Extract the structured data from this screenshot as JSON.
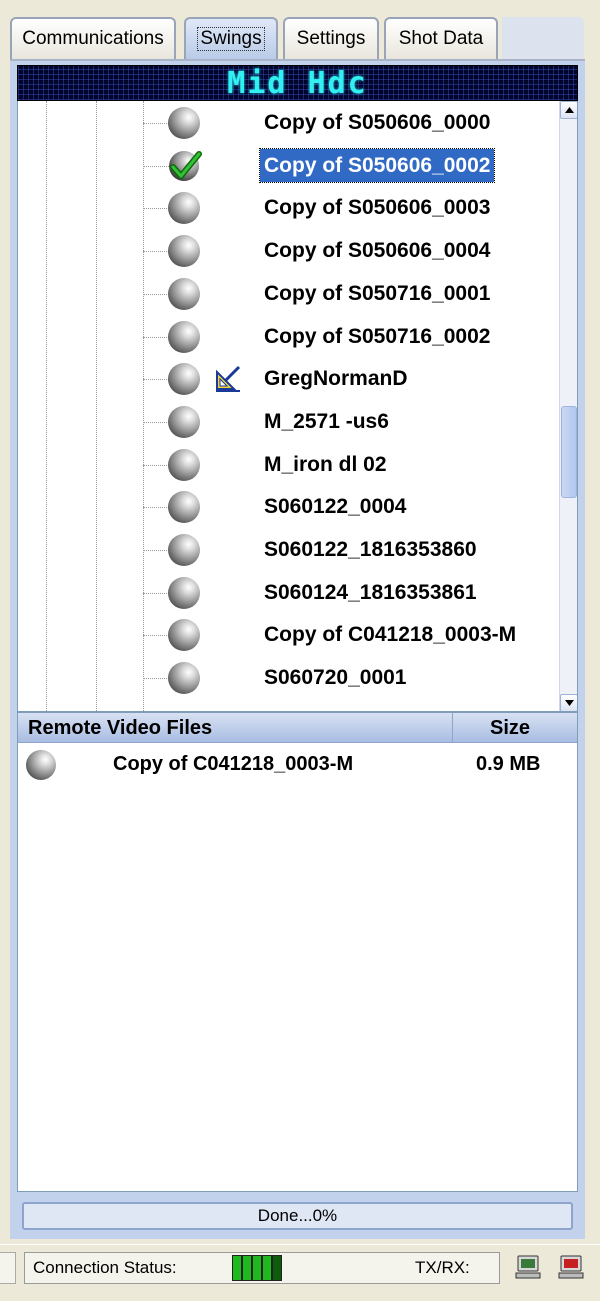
{
  "tabs": [
    {
      "label": "Communications",
      "active": false
    },
    {
      "label": "Swings",
      "active": true
    },
    {
      "label": "Settings",
      "active": false
    },
    {
      "label": "Shot Data",
      "active": false
    }
  ],
  "lcd_title": "Mid Hdc",
  "swing_tree": {
    "items": [
      {
        "label": "Copy of S050606_0000",
        "icon": "golf-ball-icon",
        "selected": false
      },
      {
        "label": "Copy of S050606_0002",
        "icon": "green-check-icon",
        "selected": true
      },
      {
        "label": "Copy of S050606_0003",
        "icon": "golf-ball-icon",
        "selected": false
      },
      {
        "label": "Copy of S050606_0004",
        "icon": "golf-ball-icon",
        "selected": false
      },
      {
        "label": "Copy of S050716_0001",
        "icon": "golf-ball-icon",
        "selected": false
      },
      {
        "label": "Copy of S050716_0002",
        "icon": "golf-ball-icon",
        "selected": false
      },
      {
        "label": "GregNormanD",
        "icon": "golf-ball-icon",
        "extra_icon": "drawing-tool-icon",
        "selected": false
      },
      {
        "label": "M_2571 -us6",
        "icon": "golf-ball-icon",
        "selected": false
      },
      {
        "label": "M_iron dl 02",
        "icon": "golf-ball-icon",
        "selected": false
      },
      {
        "label": "S060122_0004",
        "icon": "golf-ball-icon",
        "selected": false
      },
      {
        "label": "S060122_1816353860",
        "icon": "golf-ball-icon",
        "selected": false
      },
      {
        "label": "S060124_1816353861",
        "icon": "golf-ball-icon",
        "selected": false
      },
      {
        "label": "Copy of C041218_0003-M",
        "icon": "golf-ball-icon",
        "selected": false
      },
      {
        "label": "S060720_0001",
        "icon": "golf-ball-icon",
        "selected": false
      }
    ]
  },
  "remote_files": {
    "columns": {
      "name": "Remote Video Files",
      "size": "Size"
    },
    "rows": [
      {
        "name": "Copy of C041218_0003-M",
        "size": "0.9 MB"
      }
    ]
  },
  "progress": {
    "text": "Done...0%",
    "percent": 0
  },
  "status_bar": {
    "connection_label": "Connection Status:",
    "signal_bars_lit": 4,
    "txrx_label": "TX/RX:"
  },
  "colors": {
    "selection": "#316ac5",
    "lcd_text": "#33f0f0",
    "panel_bg": "#c2d2ec",
    "signal_green": "#1fb81f"
  }
}
